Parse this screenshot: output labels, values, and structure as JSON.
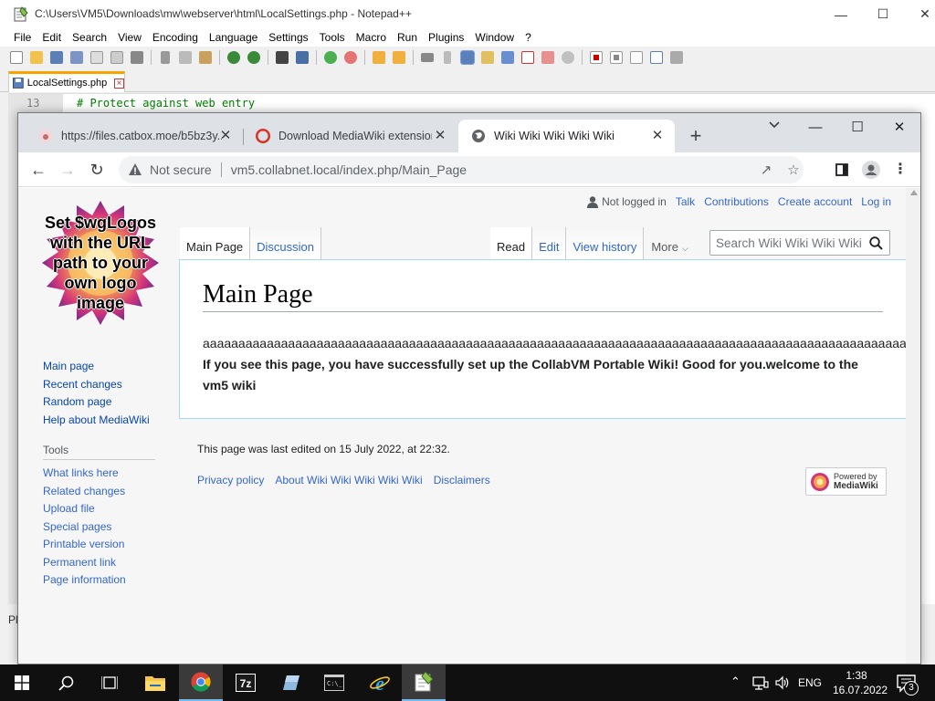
{
  "npp": {
    "title": "C:\\Users\\VM5\\Downloads\\mw\\webserver\\html\\LocalSettings.php - Notepad++",
    "menu": [
      "File",
      "Edit",
      "Search",
      "View",
      "Encoding",
      "Language",
      "Settings",
      "Tools",
      "Macro",
      "Run",
      "Plugins",
      "Window",
      "?"
    ],
    "tab_label": "LocalSettings.php",
    "line_number": "13",
    "code_line": "# Protect against web entry",
    "status_left": "Pl"
  },
  "chrome": {
    "tabs": [
      {
        "title": "https://files.catbox.moe/b5bz3y...",
        "favicon_color": "#e8a0a0",
        "active": false
      },
      {
        "title": "Download MediaWiki extension",
        "favicon_color": "#d93025",
        "active": false
      },
      {
        "title": "Wiki Wiki Wiki Wiki Wiki",
        "favicon_color": "#5f6368",
        "active": true
      }
    ],
    "new_tab": "+",
    "not_secure": "Not secure",
    "url": "vm5.collabnet.local/index.php/Main_Page"
  },
  "wiki": {
    "personal": {
      "not_logged_in": "Not logged in",
      "talk": "Talk",
      "contributions": "Contributions",
      "create_account": "Create account",
      "log_in": "Log in"
    },
    "logo_text": "Set $wgLogos with the URL path to your own logo image",
    "left_tabs": [
      {
        "label": "Main Page",
        "selected": true
      },
      {
        "label": "Discussion",
        "selected": false
      }
    ],
    "right_tabs": [
      {
        "label": "Read",
        "selected": true
      },
      {
        "label": "Edit",
        "selected": false
      },
      {
        "label": "View history",
        "selected": false
      }
    ],
    "more_label": "More",
    "search_placeholder": "Search Wiki Wiki Wiki Wiki Wiki",
    "heading": "Main Page",
    "aaa_text": "aaaaaaaaaaaaaaaaaaaaaaaaaaaaaaaaaaaaaaaaaaaaaaaaaaaaaaaaaaaaaaaaaaaaaaaaaaaaaaaaaaaaaaaaaaaaaaaaaaaaaaaaaaaaaaaaaaa",
    "welcome_text": "If you see this page, you have successfully set up the CollabVM Portable Wiki! Good for you.welcome to the vm5 wiki",
    "nav_links": [
      "Main page",
      "Recent changes",
      "Random page",
      "Help about MediaWiki"
    ],
    "tools_heading": "Tools",
    "tools_links": [
      "What links here",
      "Related changes",
      "Upload file",
      "Special pages",
      "Printable version",
      "Permanent link",
      "Page information"
    ],
    "last_edited": "This page was last edited on 15 July 2022, at 22:32.",
    "footer_links": [
      "Privacy policy",
      "About Wiki Wiki Wiki Wiki Wiki",
      "Disclaimers"
    ],
    "powered_by_line1": "Powered by",
    "powered_by_line2": "MediaWiki"
  },
  "taskbar": {
    "apps": [
      "start-icon",
      "search-icon",
      "task-view-icon",
      "file-explorer-icon",
      "chrome-icon",
      "7zip-icon",
      "app-icon",
      "cmd-icon",
      "internet-explorer-icon",
      "notepadpp-icon"
    ],
    "language": "ENG",
    "time": "1:38",
    "date": "16.07.2022",
    "notification_count": "3"
  },
  "colors": {
    "link": "#3366cc",
    "visited_link": "#0645ad",
    "chrome_tabstrip": "#dee1e6",
    "taskbar": "#101010"
  }
}
